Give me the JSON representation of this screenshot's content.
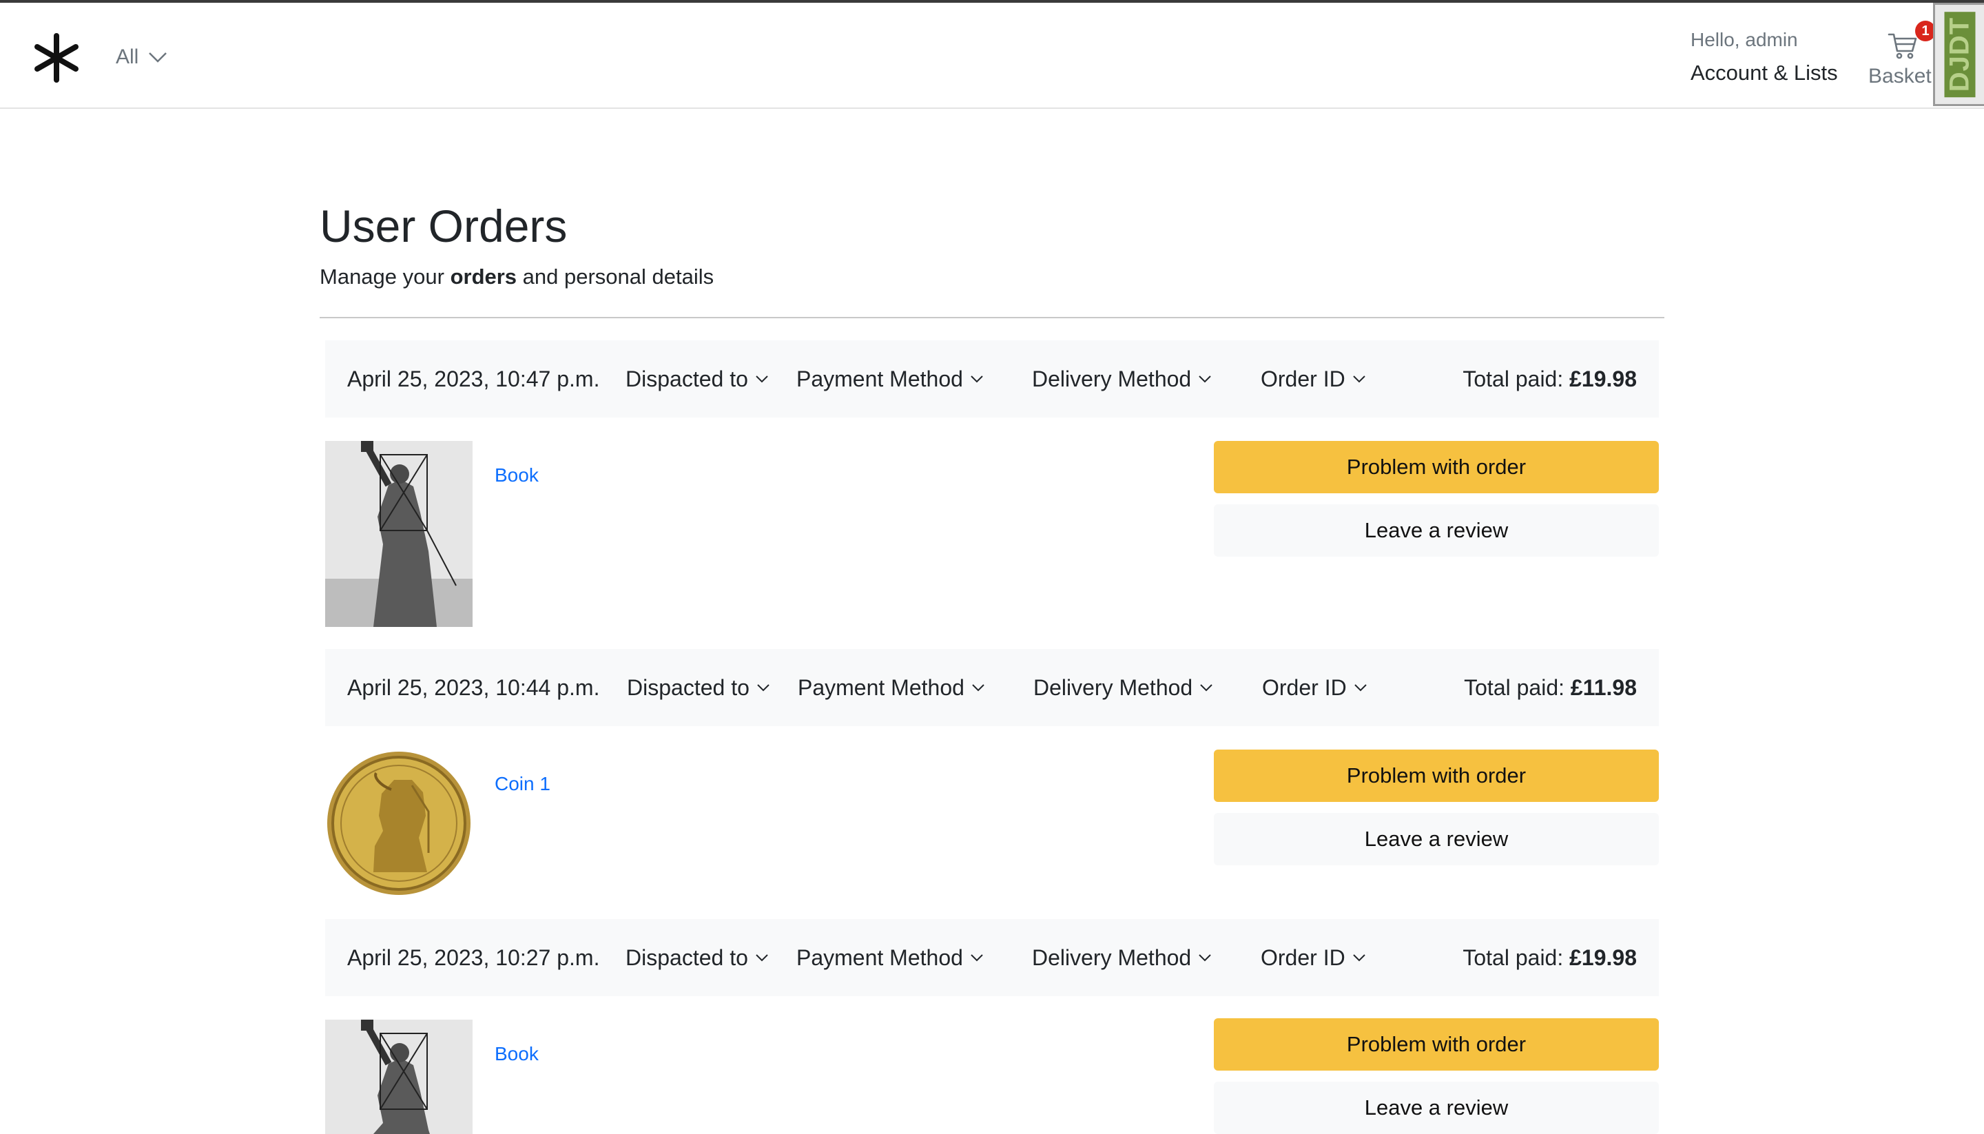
{
  "header": {
    "dept_label": "All",
    "greeting": "Hello, admin",
    "account_label": "Account & Lists",
    "basket_label": "Basket",
    "basket_count": "1",
    "debug_toolbar_label": "DJDT"
  },
  "page": {
    "title": "User Orders",
    "subtitle_pre": "Manage your ",
    "subtitle_bold": "orders",
    "subtitle_post": " and personal details"
  },
  "orders": [
    {
      "date": "April 25, 2023, 10:47 p.m.",
      "dispatched": "Dispacted to",
      "payment": "Payment Method",
      "delivery": "Delivery Method",
      "order_id": "Order ID",
      "total_label": "Total paid:",
      "total_value": "£19.98",
      "item_name": "Book",
      "item_image": "statue-of-liberty-engraving",
      "problem_label": "Problem with order",
      "review_label": "Leave a review"
    },
    {
      "date": "April 25, 2023, 10:44 p.m.",
      "dispatched": "Dispacted to",
      "payment": "Payment Method",
      "delivery": "Delivery Method",
      "order_id": "Order ID",
      "total_label": "Total paid:",
      "total_value": "£11.98",
      "item_name": "Coin 1",
      "item_image": "gold-coin-cleopatra",
      "problem_label": "Problem with order",
      "review_label": "Leave a review"
    },
    {
      "date": "April 25, 2023, 10:27 p.m.",
      "dispatched": "Dispacted to",
      "payment": "Payment Method",
      "delivery": "Delivery Method",
      "order_id": "Order ID",
      "total_label": "Total paid:",
      "total_value": "£19.98",
      "item_name": "Book",
      "item_image": "statue-of-liberty-engraving",
      "problem_label": "Problem with order",
      "review_label": "Leave a review"
    }
  ],
  "colors": {
    "accent_button": "#f6c140",
    "link": "#0d6efd",
    "badge": "#d9261c",
    "header_bg": "#f8f9fa"
  }
}
